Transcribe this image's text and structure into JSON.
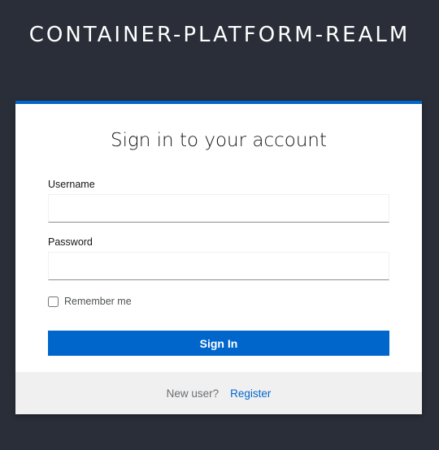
{
  "header": {
    "realm_name": "CONTAINER-PLATFORM-REALM"
  },
  "login_card": {
    "title": "Sign in to your account",
    "username": {
      "label": "Username",
      "value": ""
    },
    "password": {
      "label": "Password",
      "value": ""
    },
    "remember_me": {
      "label": "Remember me",
      "checked": false
    },
    "submit_label": "Sign In"
  },
  "footer": {
    "new_user_text": "New user?",
    "register_label": "Register"
  },
  "colors": {
    "background": "#292e38",
    "accent": "#0066cc",
    "footer_background": "#f0f0f0"
  }
}
